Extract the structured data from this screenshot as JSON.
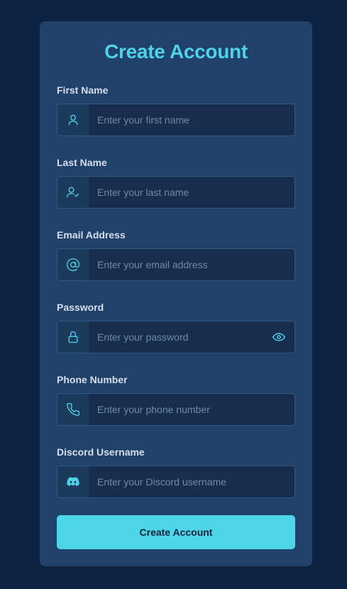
{
  "form": {
    "title": "Create Account",
    "fields": [
      {
        "label": "First Name",
        "placeholder": "Enter your first name",
        "icon": "user-icon"
      },
      {
        "label": "Last Name",
        "placeholder": "Enter your last name",
        "icon": "user-check-icon"
      },
      {
        "label": "Email Address",
        "placeholder": "Enter your email address",
        "icon": "at-sign-icon"
      },
      {
        "label": "Password",
        "placeholder": "Enter your password",
        "icon": "lock-icon",
        "toggle_icon": "eye-icon"
      },
      {
        "label": "Phone Number",
        "placeholder": "Enter your phone number",
        "icon": "phone-icon"
      },
      {
        "label": "Discord Username",
        "placeholder": "Enter your Discord username",
        "icon": "discord-icon"
      }
    ],
    "submit_label": "Create Account"
  },
  "colors": {
    "page_background": "#0b2240",
    "card_background": "#20416a",
    "accent": "#4fd1e8",
    "input_background": "#172d4d",
    "label_text": "#d5deea"
  }
}
